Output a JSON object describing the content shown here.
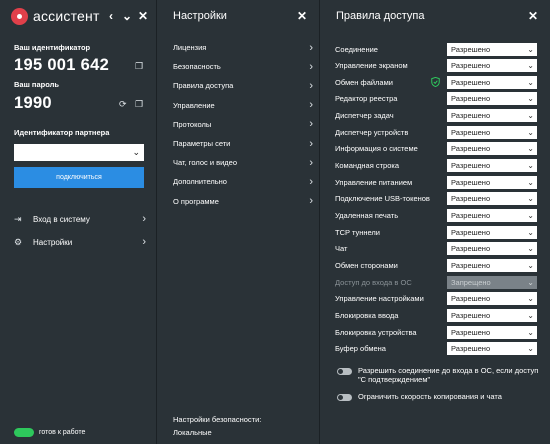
{
  "app": {
    "title": "ассистент"
  },
  "window_controls": {
    "back": "‹",
    "down": "⌄",
    "close": "✕"
  },
  "identity": {
    "id_label": "Ваш идентификатор",
    "id_value": "195 001 642",
    "password_label": "Ваш пароль",
    "password_value": "1990",
    "partner_label": "Идентификатор партнера",
    "partner_value": "",
    "connect_label": "подключиться"
  },
  "left_nav": [
    {
      "label": "Вход в систему",
      "icon": "login-icon"
    },
    {
      "label": "Настройки",
      "icon": "gear-icon"
    }
  ],
  "status": {
    "label": "готов к работе",
    "color": "#2ec85c"
  },
  "settings": {
    "title": "Настройки",
    "items": [
      {
        "label": "Лицензия"
      },
      {
        "label": "Безопасность"
      },
      {
        "label": "Правила доступа"
      },
      {
        "label": "Управление"
      },
      {
        "label": "Протоколы"
      },
      {
        "label": "Параметры сети"
      },
      {
        "label": "Чат, голос и видео"
      },
      {
        "label": "Дополнительно"
      },
      {
        "label": "О программе"
      }
    ],
    "security_settings_label": "Настройки безопасности:",
    "security_settings_value": "Локальные"
  },
  "access_rules": {
    "title": "Правила доступа",
    "rules": [
      {
        "label": "Соединение",
        "value": "Разрешено"
      },
      {
        "label": "Управление экраном",
        "value": "Разрешено"
      },
      {
        "label": "Обмен файлами",
        "value": "Разрешено",
        "shield": true
      },
      {
        "label": "Редактор реестра",
        "value": "Разрешено"
      },
      {
        "label": "Диспетчер задач",
        "value": "Разрешено"
      },
      {
        "label": "Диспетчер устройств",
        "value": "Разрешено"
      },
      {
        "label": "Информация о системе",
        "value": "Разрешено"
      },
      {
        "label": "Командная строка",
        "value": "Разрешено"
      },
      {
        "label": "Управление питанием",
        "value": "Разрешено"
      },
      {
        "label": "Подключение USB-токенов",
        "value": "Разрешено"
      },
      {
        "label": "Удаленная печать",
        "value": "Разрешено"
      },
      {
        "label": "TCP туннели",
        "value": "Разрешено"
      },
      {
        "label": "Чат",
        "value": "Разрешено"
      },
      {
        "label": "Обмен сторонами",
        "value": "Разрешено"
      },
      {
        "label": "Доступ до входа в ОС",
        "value": "Запрещено",
        "disabled": true
      },
      {
        "label": "Управление настройками",
        "value": "Разрешено"
      },
      {
        "label": "Блокировка ввода",
        "value": "Разрешено"
      },
      {
        "label": "Блокировка устройства",
        "value": "Разрешено"
      },
      {
        "label": "Буфер обмена",
        "value": "Разрешено"
      }
    ],
    "options": [
      {
        "label": "Разрешить соединение до входа в ОС, если доступ \"С подтверждением\"",
        "enabled": false
      },
      {
        "label": "Ограничить скорость копирования и чата",
        "enabled": false
      }
    ]
  },
  "colors": {
    "background": "#2a3237",
    "accent": "#2b8de3",
    "logo": "#e0404a",
    "shield": "#2ec85c"
  }
}
